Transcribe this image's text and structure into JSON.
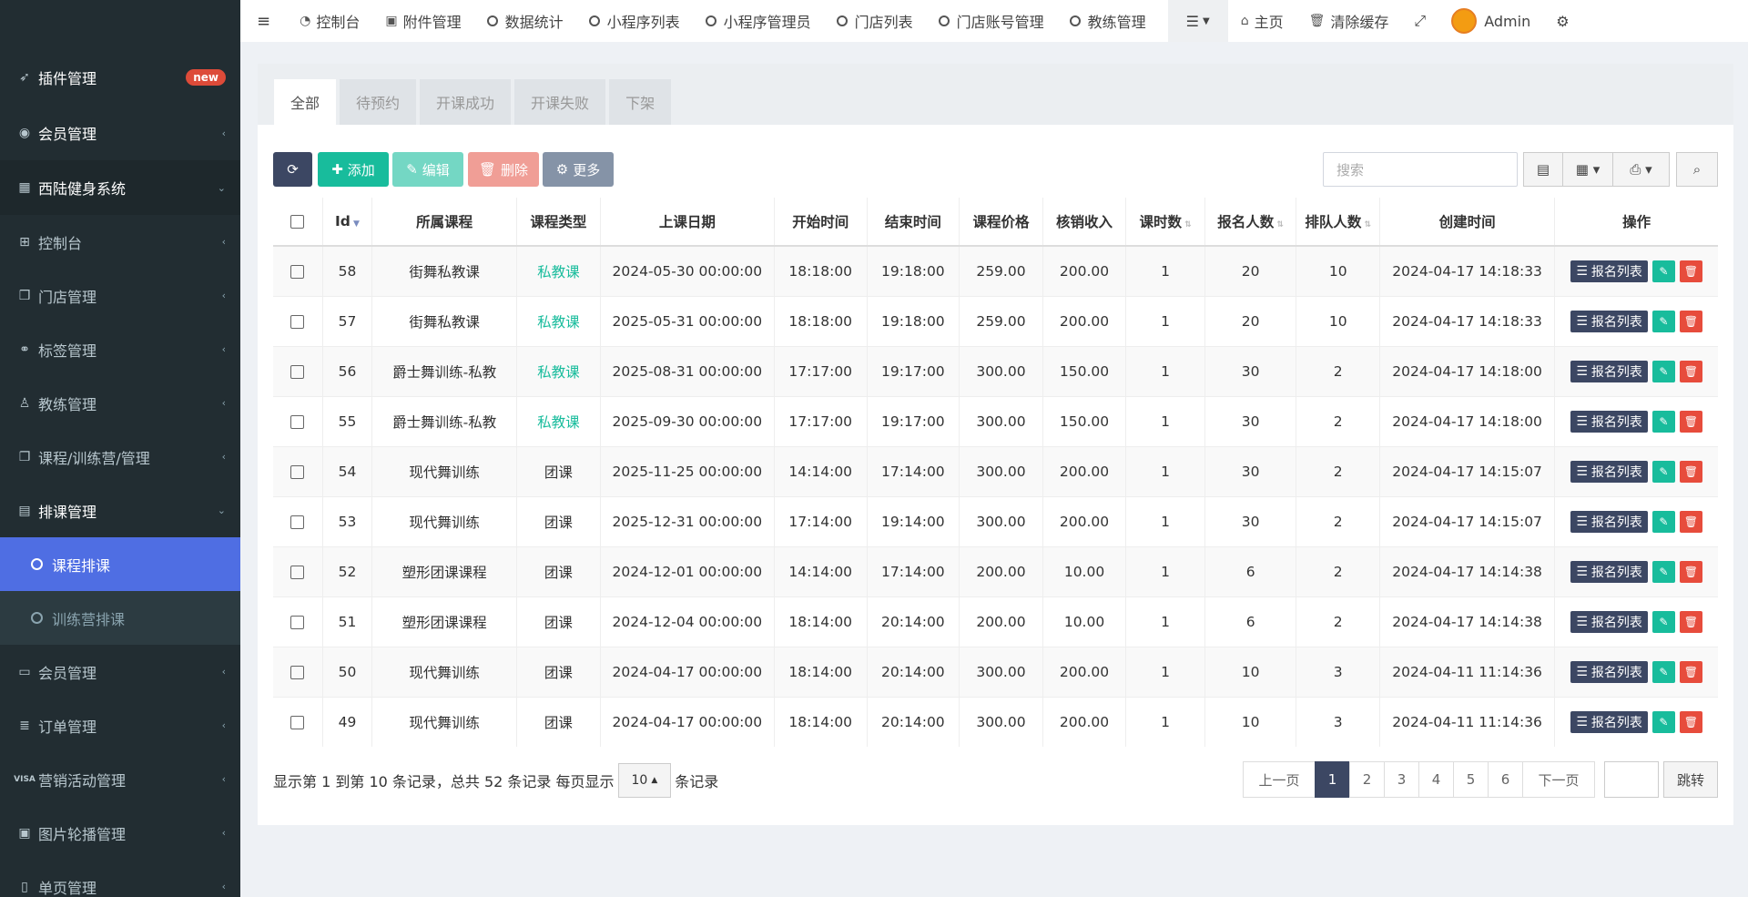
{
  "sidebar": {
    "items": [
      {
        "label": "插件管理",
        "icon": "rocket-icon",
        "badge": "new"
      },
      {
        "label": "会员管理",
        "icon": "user-circle-icon"
      },
      {
        "label": "西陆健身系统",
        "icon": "store-icon"
      },
      {
        "label": "控制台",
        "icon": "windows-icon"
      },
      {
        "label": "门店管理",
        "icon": "cubes-icon"
      },
      {
        "label": "标签管理",
        "icon": "link-icon"
      },
      {
        "label": "教练管理",
        "icon": "person-icon"
      },
      {
        "label": "课程/训练营/管理",
        "icon": "copy-icon"
      },
      {
        "label": "排课管理",
        "icon": "calendar-icon"
      },
      {
        "label": "会员管理",
        "icon": "id-card-icon"
      },
      {
        "label": "订单管理",
        "icon": "database-icon"
      },
      {
        "label": "营销活动管理",
        "icon": "visa-icon"
      },
      {
        "label": "图片轮播管理",
        "icon": "image-icon"
      },
      {
        "label": "单页管理",
        "icon": "file-icon"
      }
    ],
    "sub_items": [
      {
        "label": "课程排课"
      },
      {
        "label": "训练营排课"
      }
    ]
  },
  "topbar": {
    "nav": [
      {
        "label": "控制台",
        "icon": "dashboard-icon"
      },
      {
        "label": "附件管理",
        "icon": "image-icon"
      },
      {
        "label": "数据统计",
        "icon": "circle-icon"
      },
      {
        "label": "小程序列表",
        "icon": "circle-icon"
      },
      {
        "label": "小程序管理员",
        "icon": "circle-icon"
      },
      {
        "label": "门店列表",
        "icon": "circle-icon"
      },
      {
        "label": "门店账号管理",
        "icon": "circle-icon"
      },
      {
        "label": "教练管理",
        "icon": "circle-icon"
      }
    ],
    "home": "主页",
    "clear_cache": "清除缓存",
    "user": "Admin"
  },
  "tabs": [
    "全部",
    "待预约",
    "开课成功",
    "开课失败",
    "下架"
  ],
  "toolbar": {
    "add": "添加",
    "edit": "编辑",
    "delete": "删除",
    "more": "更多",
    "search_placeholder": "搜索"
  },
  "table": {
    "headers": [
      "Id",
      "所属课程",
      "课程类型",
      "上课日期",
      "开始时间",
      "结束时间",
      "课程价格",
      "核销收入",
      "课时数",
      "报名人数",
      "排队人数",
      "创建时间",
      "操作"
    ],
    "rows": [
      {
        "id": "58",
        "course": "街舞私教课",
        "type": "私教课",
        "date": "2024-05-30 00:00:00",
        "start": "18:18:00",
        "end": "19:18:00",
        "price": "259.00",
        "income": "200.00",
        "hours": "1",
        "signups": "20",
        "queue": "10",
        "created": "2024-04-17 14:18:33"
      },
      {
        "id": "57",
        "course": "街舞私教课",
        "type": "私教课",
        "date": "2025-05-31 00:00:00",
        "start": "18:18:00",
        "end": "19:18:00",
        "price": "259.00",
        "income": "200.00",
        "hours": "1",
        "signups": "20",
        "queue": "10",
        "created": "2024-04-17 14:18:33"
      },
      {
        "id": "56",
        "course": "爵士舞训练-私教",
        "type": "私教课",
        "date": "2025-08-31 00:00:00",
        "start": "17:17:00",
        "end": "19:17:00",
        "price": "300.00",
        "income": "150.00",
        "hours": "1",
        "signups": "30",
        "queue": "2",
        "created": "2024-04-17 14:18:00"
      },
      {
        "id": "55",
        "course": "爵士舞训练-私教",
        "type": "私教课",
        "date": "2025-09-30 00:00:00",
        "start": "17:17:00",
        "end": "19:17:00",
        "price": "300.00",
        "income": "150.00",
        "hours": "1",
        "signups": "30",
        "queue": "2",
        "created": "2024-04-17 14:18:00"
      },
      {
        "id": "54",
        "course": "现代舞训练",
        "type": "团课",
        "date": "2025-11-25 00:00:00",
        "start": "14:14:00",
        "end": "17:14:00",
        "price": "300.00",
        "income": "200.00",
        "hours": "1",
        "signups": "30",
        "queue": "2",
        "created": "2024-04-17 14:15:07"
      },
      {
        "id": "53",
        "course": "现代舞训练",
        "type": "团课",
        "date": "2025-12-31 00:00:00",
        "start": "17:14:00",
        "end": "19:14:00",
        "price": "300.00",
        "income": "200.00",
        "hours": "1",
        "signups": "30",
        "queue": "2",
        "created": "2024-04-17 14:15:07"
      },
      {
        "id": "52",
        "course": "塑形团课课程",
        "type": "团课",
        "date": "2024-12-01 00:00:00",
        "start": "14:14:00",
        "end": "17:14:00",
        "price": "200.00",
        "income": "10.00",
        "hours": "1",
        "signups": "6",
        "queue": "2",
        "created": "2024-04-17 14:14:38"
      },
      {
        "id": "51",
        "course": "塑形团课课程",
        "type": "团课",
        "date": "2024-12-04 00:00:00",
        "start": "18:14:00",
        "end": "20:14:00",
        "price": "200.00",
        "income": "10.00",
        "hours": "1",
        "signups": "6",
        "queue": "2",
        "created": "2024-04-17 14:14:38"
      },
      {
        "id": "50",
        "course": "现代舞训练",
        "type": "团课",
        "date": "2024-04-17 00:00:00",
        "start": "18:14:00",
        "end": "20:14:00",
        "price": "300.00",
        "income": "200.00",
        "hours": "1",
        "signups": "10",
        "queue": "3",
        "created": "2024-04-11 11:14:36"
      },
      {
        "id": "49",
        "course": "现代舞训练",
        "type": "团课",
        "date": "2024-04-17 00:00:00",
        "start": "18:14:00",
        "end": "20:14:00",
        "price": "300.00",
        "income": "200.00",
        "hours": "1",
        "signups": "10",
        "queue": "3",
        "created": "2024-04-11 11:14:36"
      }
    ],
    "op_list_label": "报名列表"
  },
  "footer": {
    "info_prefix": "显示第 1 到第 10 条记录，总共 52 条记录 每页显示",
    "page_size": "10",
    "info_suffix": "条记录",
    "prev": "上一页",
    "next": "下一页",
    "pages": [
      "1",
      "2",
      "3",
      "4",
      "5",
      "6"
    ],
    "jump": "跳转"
  },
  "colors": {
    "accent": "#4f6ee3",
    "success": "#18bc9c",
    "danger": "#e74c3c",
    "dark": "#3c4763"
  }
}
